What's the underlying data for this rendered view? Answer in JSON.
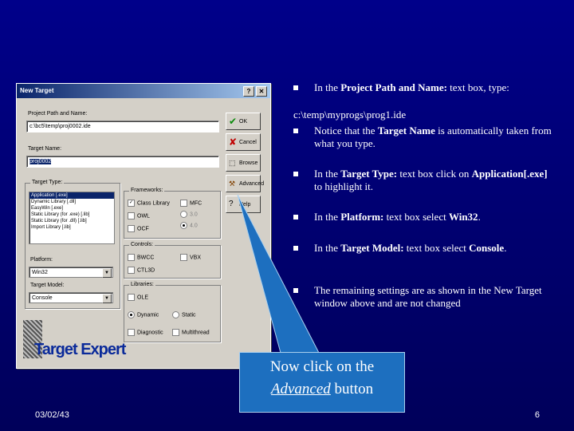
{
  "dialog": {
    "title": "New Target",
    "help_btn": "?",
    "close_btn": "✕",
    "project_label": "Project Path and Name:",
    "project_value": "c:\\bc5\\temp\\proj0002.ide",
    "target_name_label": "Target Name:",
    "target_name_value": "proj0002",
    "target_type_label": "Target Type:",
    "target_types": [
      "Application [.exe]",
      "Dynamic Library [.dll]",
      "EasyWin [.exe]",
      "Static Library (for .exe) [.lib]",
      "Static Library (for .dll) [.lib]",
      "Import Library [.lib]"
    ],
    "platform_label": "Platform:",
    "platform_value": "Win32",
    "target_model_label": "Target Model:",
    "target_model_value": "Console",
    "frameworks_label": "Frameworks:",
    "fw_class_library": "Class Library",
    "fw_mfc": "MFC",
    "fw_owl": "OWL",
    "fw_ocf": "OCF",
    "fw_opt1": "3.0",
    "fw_opt2": "4.0",
    "controls_label": "Controls:",
    "ctl_bwcc": "BWCC",
    "ctl_vbx": "VBX",
    "ctl_ctl3d": "CTL3D",
    "libraries_label": "Libraries:",
    "lib_ole": "OLE",
    "lib_dynamic": "Dynamic",
    "lib_static": "Static",
    "lib_diagnostic": "Diagnostic",
    "lib_multithread": "Multithread",
    "btn_ok": "OK",
    "btn_cancel": "Cancel",
    "btn_browse": "Browse",
    "btn_advanced": "Advanced",
    "btn_help": "Help",
    "logo_text": "Target Expert"
  },
  "bullets": [
    {
      "pre": "In the ",
      "bold": "Project Path and Name:",
      "post": " text box, type:"
    },
    {
      "plain": "c:\\temp\\myprogs\\prog1.ide"
    },
    {
      "pre": "Notice that the ",
      "bold": "Target Name",
      "post": " is automatically taken from what you type."
    },
    {
      "pre": "In the ",
      "bold": "Target Type:",
      "post": " text box click on ",
      "bold2": "Application[.exe]",
      "post2": " to highlight it."
    },
    {
      "pre": "In the ",
      "bold": "Platform:",
      "post": " text box select ",
      "bold2": "Win32",
      "post2": "."
    },
    {
      "pre": "In the ",
      "bold": "Target Model:",
      "post": " text box select ",
      "bold2": "Console",
      "post2": "."
    },
    {
      "pre": "The remaining settings are as shown in the New Target window above and are not changed",
      "bold": "",
      "post": ""
    }
  ],
  "callout": {
    "line1": "Now click on the",
    "line2_em": "Advanced",
    "line2_rest": " button"
  },
  "footer": {
    "date": "03/02/43",
    "page": "6"
  },
  "colors": {
    "background": "#00008a",
    "callout": "#1d6fbf",
    "title_bar": "#0a246a"
  }
}
